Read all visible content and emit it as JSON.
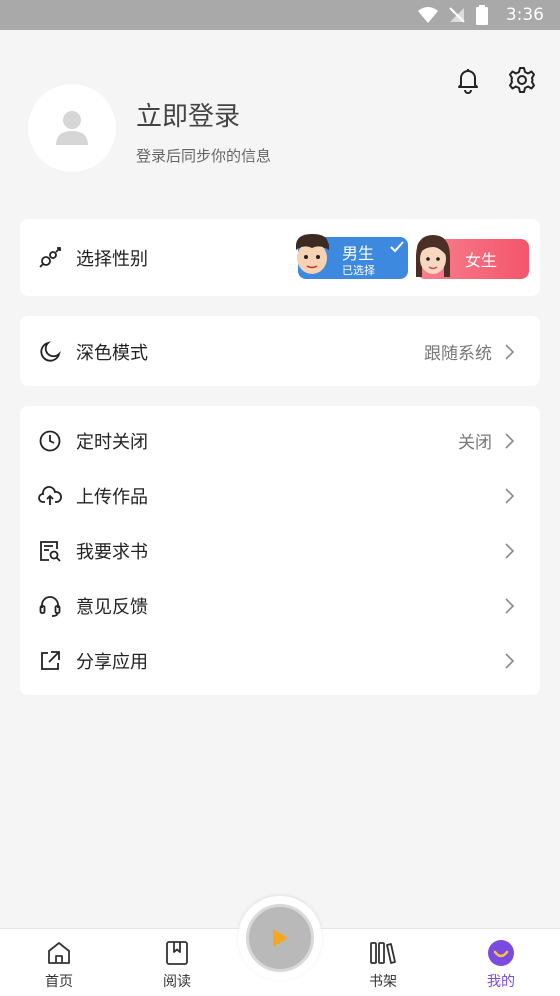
{
  "status_bar": {
    "time": "3:36"
  },
  "profile": {
    "login_title": "立即登录",
    "login_subtitle": "登录后同步你的信息"
  },
  "gender": {
    "label": "选择性别",
    "male": {
      "label": "男生",
      "selected_text": "已选择"
    },
    "female": {
      "label": "女生"
    }
  },
  "dark_mode": {
    "label": "深色模式",
    "value": "跟随系统"
  },
  "settings_list": [
    {
      "label": "定时关闭",
      "value": "关闭",
      "icon": "clock-icon"
    },
    {
      "label": "上传作品",
      "value": "",
      "icon": "cloud-upload-icon"
    },
    {
      "label": "我要求书",
      "value": "",
      "icon": "book-search-icon"
    },
    {
      "label": "意见反馈",
      "value": "",
      "icon": "headset-icon"
    },
    {
      "label": "分享应用",
      "value": "",
      "icon": "share-icon"
    }
  ],
  "tabbar": {
    "tabs": [
      {
        "label": "首页",
        "icon": "home-icon"
      },
      {
        "label": "阅读",
        "icon": "bookmark-book-icon"
      },
      {
        "label": "书架",
        "icon": "bookshelf-icon"
      },
      {
        "label": "我的",
        "icon": "profile-smile-icon"
      }
    ],
    "active_index": 3
  },
  "colors": {
    "accent": "#7a4be0",
    "male": "#3d89e0",
    "female": "#f4556c",
    "play": "#f5a623"
  }
}
